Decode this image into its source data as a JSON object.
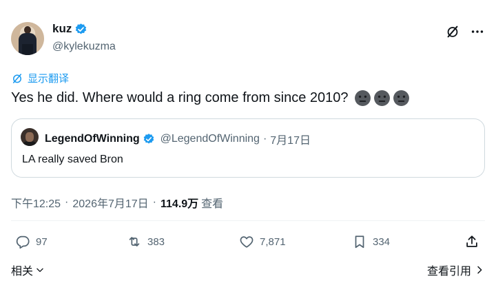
{
  "author": {
    "display_name": "kuz",
    "handle": "@kylekuzma",
    "verified": true
  },
  "translate": {
    "label": "显示翻译",
    "icon": "translate-icon"
  },
  "tweet": {
    "text": "Yes he did. Where would a ring come from since 2010?",
    "emoji_count": 3
  },
  "quoted_tweet": {
    "display_name": "LegendOfWinning",
    "handle": "@LegendOfWinning",
    "separator": "·",
    "date": "7月17日",
    "text": "LA really saved Bron",
    "verified": true
  },
  "meta": {
    "time": "下午12:25",
    "separator": "·",
    "date": "2026年7月17日",
    "views_count": "114.9万",
    "views_label": "查看"
  },
  "stats": {
    "replies": "97",
    "retweets": "383",
    "likes": "7,871",
    "bookmarks": "334"
  },
  "footer": {
    "related_label": "相关",
    "quotes_label": "查看引用"
  },
  "colors": {
    "accent": "#1d9bf0",
    "text_primary": "#0f1419",
    "text_secondary": "#536471",
    "border": "#cfd9de"
  }
}
